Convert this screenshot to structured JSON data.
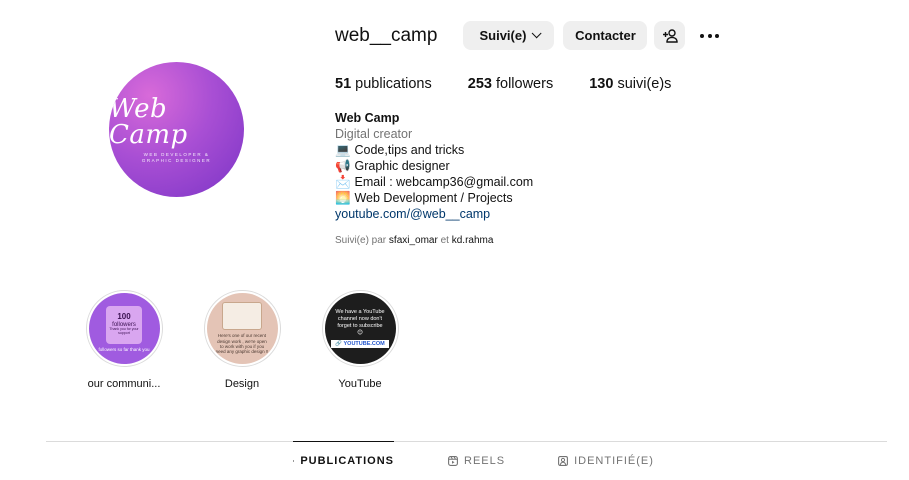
{
  "profile": {
    "username": "web__camp",
    "follow_label": "Suivi(e)",
    "contact_label": "Contacter",
    "avatar": {
      "script_text": "Web Camp",
      "sub_text": "WEB DEVELOPER & GRAPHIC DESIGNER"
    }
  },
  "stats": [
    {
      "count": "51",
      "label": "publications"
    },
    {
      "count": "253",
      "label": "followers"
    },
    {
      "count": "130",
      "label": "suivi(e)s"
    }
  ],
  "bio": {
    "name": "Web Camp",
    "category": "Digital creator",
    "lines": [
      {
        "emoji": "💻",
        "text": "Code,tips and tricks"
      },
      {
        "emoji": "📢",
        "text": "Graphic designer"
      },
      {
        "emoji": "📩",
        "text": "Email : webcamp36@gmail.com"
      },
      {
        "emoji": "🌅",
        "text": "Web Development / Projects"
      }
    ],
    "link": "youtube.com/@web__camp"
  },
  "followed_by": {
    "prefix": "Suivi(e) par",
    "user1": "sfaxi_omar",
    "joiner": "et",
    "user2": "kd.rahma"
  },
  "highlights": [
    {
      "label": "our communi...",
      "card_number": "100",
      "card_text": "followers",
      "card_sub": "Thank you for your support",
      "foot": "followers so far thank you"
    },
    {
      "label": "Design",
      "text": "Here's one of our recent design work , we're open to work with you if you need any graphic design !!"
    },
    {
      "label": "YouTube",
      "text": "We have a YouTube channel now don't forget to subscribe 😊",
      "badge": "🔗 YOUTUBE.COM"
    }
  ],
  "tabs": [
    {
      "label": "PUBLICATIONS",
      "icon": "grid-icon",
      "active": true
    },
    {
      "label": "REELS",
      "icon": "reels-icon",
      "active": false
    },
    {
      "label": "IDENTIFIÉ(E)",
      "icon": "tagged-icon",
      "active": false
    }
  ]
}
